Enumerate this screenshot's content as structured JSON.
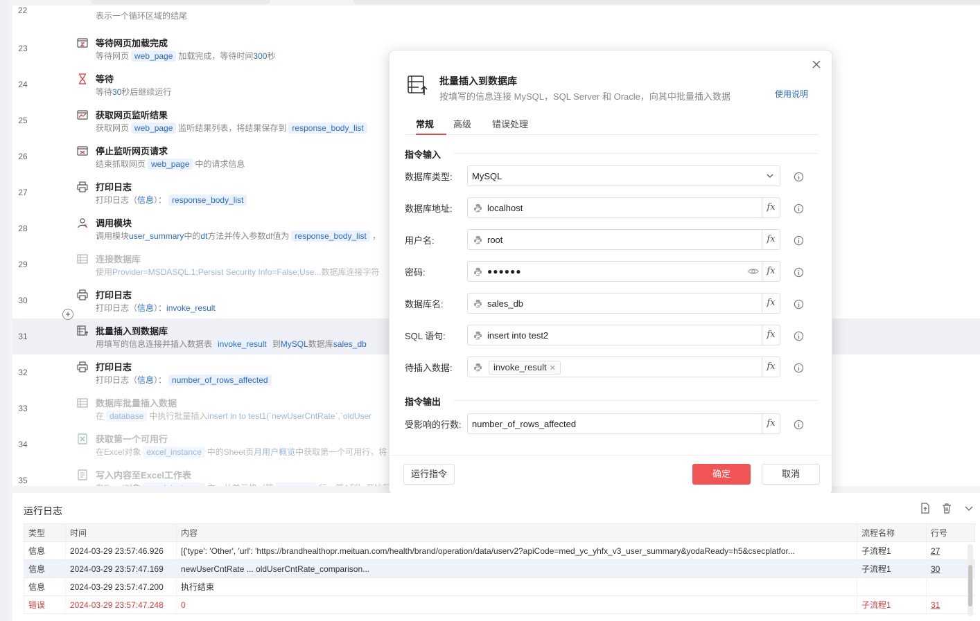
{
  "flow": {
    "top_partial_desc": "表示一个循环区域的结尾",
    "steps": [
      {
        "num": "23",
        "title": "等待网页加载完成",
        "d1": "等待网页",
        "c1": "web_page",
        "d2": "加载完成，等待时间",
        "l1": "300",
        "d3": "秒",
        "icon": "webpage-timer-icon"
      },
      {
        "num": "24",
        "title": "等待",
        "d1": "等待",
        "l1": "30",
        "d2": "秒后继续运行",
        "icon": "hourglass-icon"
      },
      {
        "num": "25",
        "title": "获取网页监听结果",
        "d1": "获取网页",
        "c1": "web_page",
        "d2": "监听结果列表，将结果保存到",
        "c2": "response_body_list",
        "icon": "webpage-chart-icon"
      },
      {
        "num": "26",
        "title": "停止监听网页请求",
        "d1": "结束抓取网页",
        "c1": "web_page",
        "d2": "中的请求信息",
        "icon": "webpage-stop-icon"
      },
      {
        "num": "27",
        "title": "打印日志",
        "d1": "打印日志（",
        "l1": "信息",
        "d2": "）：",
        "c1": "response_body_list",
        "icon": "printer-icon"
      },
      {
        "num": "28",
        "title": "调用模块",
        "d1": "调用模块",
        "l1": "user_summary",
        "d2": "中的",
        "l2": "dt",
        "d3": "方法并传入参数df值为",
        "c1": "response_body_list",
        "d4": "，",
        "icon": "module-icon"
      },
      {
        "num": "29",
        "title": "连接数据库",
        "d1": "使用",
        "l1": "Provider=MSDASQL.1;Persist Security Info=False;Use...",
        "d2": "数据库连接字符",
        "icon": "database-connect-icon"
      },
      {
        "num": "30",
        "title": "打印日志",
        "d1": "打印日志（",
        "l1": "信息",
        "d2": "）：",
        "l2": "invoke_result",
        "icon": "printer-icon"
      },
      {
        "num": "31",
        "title": "批量插入到数据库",
        "d1": "用填写的信息连接并插入数据表",
        "c1": "invoke_result",
        "d2": "到",
        "l1": "MySQL",
        "d3": "数据库",
        "l2": "sales_db",
        "icon": "db-insert-icon"
      },
      {
        "num": "32",
        "title": "打印日志",
        "d1": "打印日志（",
        "l1": "信息",
        "d2": "）：",
        "c1": "number_of_rows_affected",
        "icon": "printer-icon"
      },
      {
        "num": "33",
        "title": "数据库批量插入数据",
        "d1": "在",
        "c1": "database",
        "d2": "中执行批量插入",
        "l1": "insert in to test1(`newUserCntRate`,`oldUser",
        "icon": "db-batch-icon"
      },
      {
        "num": "34",
        "title": "获取第一个可用行",
        "d1": "在Excel对象",
        "c1": "excel_instance",
        "d2": "中的Sheet页",
        "l1": "月用户概览",
        "d3": "中获取第一个可用行，将",
        "icon": "excel-icon"
      },
      {
        "num": "35",
        "title": "写入内容至Excel工作表",
        "d1": "在Excel对象",
        "c1": "excel_instance",
        "d2": "中，从单元格（第",
        "c2": "row_num",
        "d3": "行，第A列）开始写",
        "icon": "excel-write-icon"
      }
    ]
  },
  "dialog": {
    "title": "批量插入到数据库",
    "subtitle": "按填写的信息连接 MySQL，SQL Server 和 Oracle，向其中批量插入数据",
    "help_link": "使用说明",
    "tabs": [
      "常规",
      "高级",
      "错误处理"
    ],
    "section_input": "指令输入",
    "section_output": "指令输出",
    "fields": {
      "db_type_label": "数据库类型:",
      "db_type_value": "MySQL",
      "db_host_label": "数据库地址:",
      "db_host_value": "localhost",
      "user_label": "用户名:",
      "user_value": "root",
      "password_label": "密码:",
      "password_value": "●●●●●●",
      "db_name_label": "数据库名:",
      "db_name_value": "sales_db",
      "sql_label": "SQL 语句:",
      "sql_value": "insert into test2",
      "data_label": "待插入数据:",
      "data_value": "invoke_result",
      "rows_label": "受影响的行数:",
      "rows_value": "number_of_rows_affected"
    },
    "fx_label": "fx",
    "run_button": "运行指令",
    "ok_button": "确定",
    "cancel_button": "取消",
    "accent_color": "#f05454"
  },
  "log": {
    "title": "运行日志",
    "columns": [
      "类型",
      "时间",
      "内容",
      "流程名称",
      "行号"
    ],
    "rows": [
      {
        "type": "信息",
        "time": "2024-03-29 23:57:46.926",
        "content": "[{'type': 'Other', 'url': 'https://brandhealthopr.meituan.com/health/brand/operation/data/userv2?apiCode=med_yc_yhfx_v3_user_summary&yodaReady=h5&csecplatfor...",
        "flow": "子流程1",
        "line": "27"
      },
      {
        "type": "信息",
        "time": "2024-03-29 23:57:47.169",
        "content": "    newUserCntRate  ...  oldUserCntRate_comparison...",
        "flow": "子流程1",
        "line": "30"
      },
      {
        "type": "信息",
        "time": "2024-03-29 23:57:47.200",
        "content": "执行结束",
        "flow": "",
        "line": ""
      },
      {
        "type": "错误",
        "time": "2024-03-29 23:57:47.248",
        "content": "0",
        "flow": "子流程1",
        "line": "31"
      }
    ]
  }
}
